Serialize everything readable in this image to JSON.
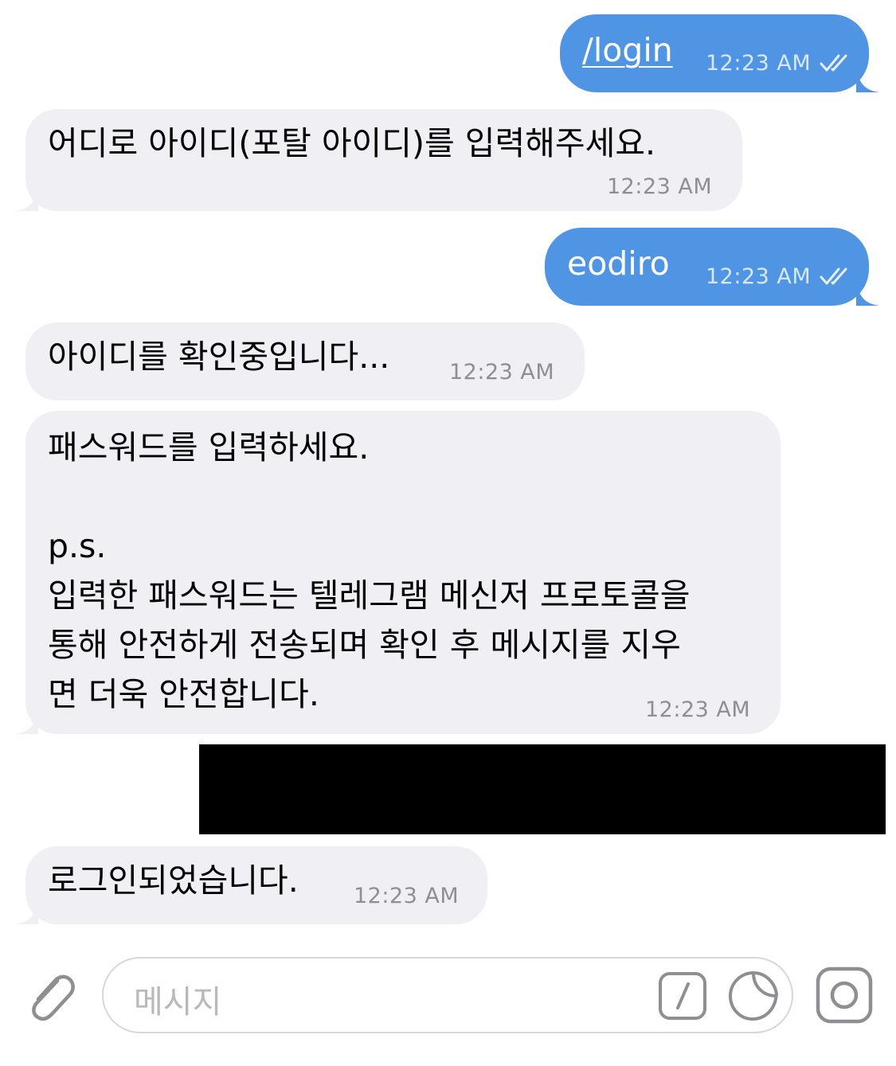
{
  "messages": [
    {
      "id": "m1",
      "direction": "outgoing",
      "text": "/login",
      "time": "12:23 AM",
      "status": "read"
    },
    {
      "id": "m2",
      "direction": "incoming",
      "text": "어디로 아이디(포탈 아이디)를 입력해주세요.",
      "time": "12:23 AM"
    },
    {
      "id": "m3",
      "direction": "outgoing",
      "text": "eodiro",
      "time": "12:23 AM",
      "status": "read"
    },
    {
      "id": "m4",
      "direction": "incoming",
      "text": "아이디를 확인중입니다...",
      "time": "12:23 AM"
    },
    {
      "id": "m5",
      "direction": "incoming",
      "lines": [
        "패스워드를 입력하세요.",
        "",
        "p.s.",
        "입력한 패스워드는 텔레그램 메신저 프로토콜을",
        "통해 안전하게 전송되며 확인 후 메시지를 지우",
        "면 더욱 안전합니다."
      ],
      "time": "12:23 AM"
    },
    {
      "id": "m6",
      "direction": "outgoing",
      "redacted": true
    },
    {
      "id": "m7",
      "direction": "incoming",
      "text": "로그인되었습니다.",
      "time": "12:23 AM"
    }
  ],
  "input_bar": {
    "placeholder": "메시지",
    "icons": [
      "paperclip-icon",
      "slash-command-icon",
      "sticker-icon",
      "camera-icon"
    ]
  },
  "colors": {
    "outgoing_bubble": "#4f95e3",
    "incoming_bubble": "#efeff4",
    "timestamp_incoming": "#8e8e93",
    "redaction": "#000000"
  }
}
